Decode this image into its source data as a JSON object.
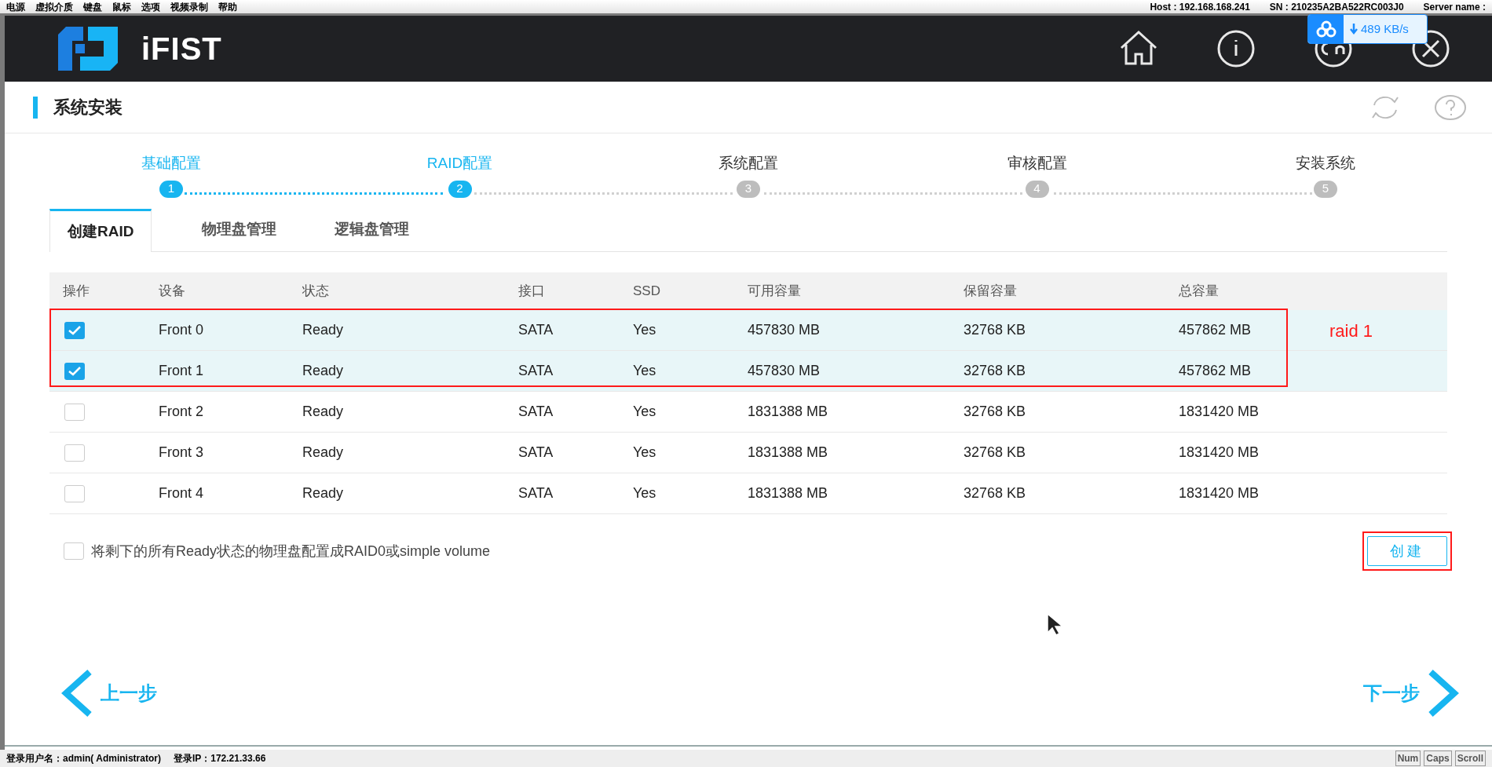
{
  "menu_bar": {
    "items": [
      "电源",
      "虚拟介质",
      "键盘",
      "鼠标",
      "选项",
      "视频录制",
      "帮助"
    ],
    "host": "Host : 192.168.168.241",
    "sn": "SN : 210235A2BA522RC003J0",
    "server": "Server name :"
  },
  "download_badge": {
    "speed": "489 KB/s"
  },
  "app_header": {
    "brand": "iFIST"
  },
  "page": {
    "title": "系统安装"
  },
  "steps": [
    {
      "label": "基础配置",
      "number": "1",
      "done": true
    },
    {
      "label": "RAID配置",
      "number": "2",
      "done": true
    },
    {
      "label": "系统配置",
      "number": "3",
      "done": false
    },
    {
      "label": "审核配置",
      "number": "4",
      "done": false
    },
    {
      "label": "安装系统",
      "number": "5",
      "done": false
    }
  ],
  "tabs": [
    {
      "label": "创建RAID",
      "selected": true
    },
    {
      "label": "物理盘管理",
      "selected": false
    },
    {
      "label": "逻辑盘管理",
      "selected": false
    }
  ],
  "table": {
    "select_header": "操作",
    "columns": [
      "设备",
      "状态",
      "接口",
      "SSD",
      "可用容量",
      "保留容量",
      "总容量"
    ],
    "rows": [
      {
        "checked": true,
        "cells": [
          "Front 0",
          "Ready",
          "SATA",
          "Yes",
          "457830 MB",
          "32768 KB",
          "457862 MB"
        ]
      },
      {
        "checked": true,
        "cells": [
          "Front 1",
          "Ready",
          "SATA",
          "Yes",
          "457830 MB",
          "32768 KB",
          "457862 MB"
        ]
      },
      {
        "checked": false,
        "cells": [
          "Front 2",
          "Ready",
          "SATA",
          "Yes",
          "1831388 MB",
          "32768 KB",
          "1831420 MB"
        ]
      },
      {
        "checked": false,
        "cells": [
          "Front 3",
          "Ready",
          "SATA",
          "Yes",
          "1831388 MB",
          "32768 KB",
          "1831420 MB"
        ]
      },
      {
        "checked": false,
        "cells": [
          "Front 4",
          "Ready",
          "SATA",
          "Yes",
          "1831388 MB",
          "32768 KB",
          "1831420 MB"
        ]
      }
    ]
  },
  "raid0_option": {
    "label": "将剩下的所有Ready状态的物理盘配置成RAID0或simple volume",
    "checked": false
  },
  "create_button": "创建",
  "annotation": {
    "label": "raid 1"
  },
  "nav": {
    "prev": "上一步",
    "next": "下一步"
  },
  "status_bar": {
    "user": "登录用户名：admin( Administrator)",
    "ip": "登录IP：172.21.33.66",
    "keys": [
      "Num",
      "Caps",
      "Scroll"
    ]
  }
}
